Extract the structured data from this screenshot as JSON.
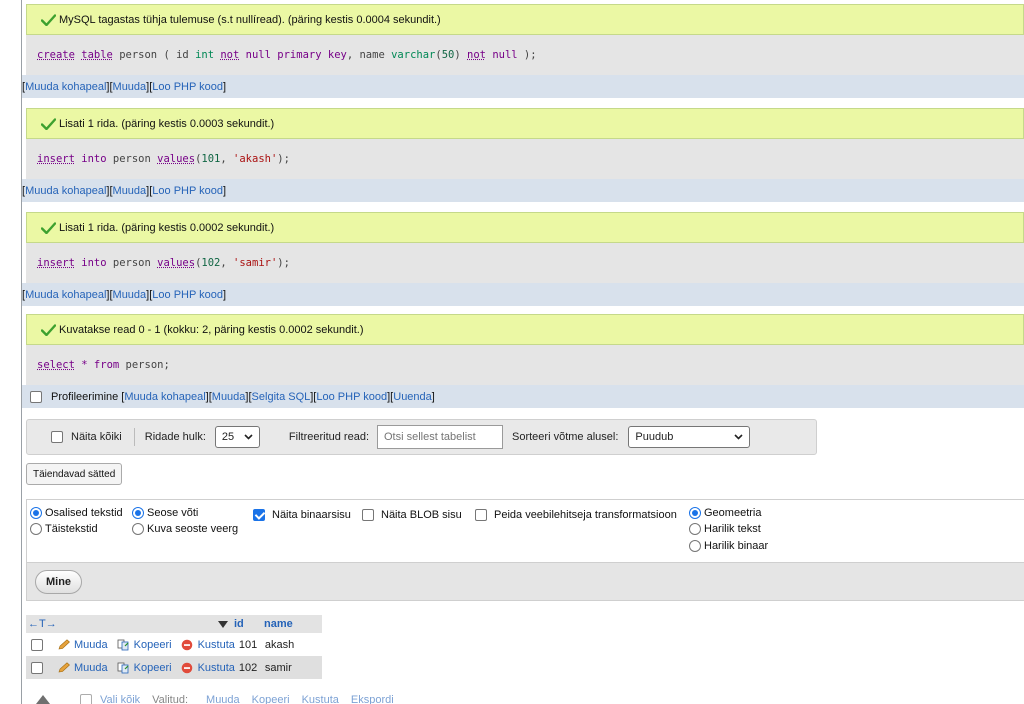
{
  "blocks": [
    {
      "message": "MySQL tagastas tühja tulemuse (s.t nullíread). (päring kestis 0.0004 sekundit.)",
      "sql": [
        {
          "t": "create",
          "c": "kwu"
        },
        {
          "t": " ",
          "c": "plain"
        },
        {
          "t": "table",
          "c": "kwu"
        },
        {
          "t": " person ( id ",
          "c": "plain"
        },
        {
          "t": "int",
          "c": "type"
        },
        {
          "t": " ",
          "c": "plain"
        },
        {
          "t": "not",
          "c": "kwu"
        },
        {
          "t": " ",
          "c": "plain"
        },
        {
          "t": "null",
          "c": "kw"
        },
        {
          "t": " ",
          "c": "plain"
        },
        {
          "t": "primary",
          "c": "kw"
        },
        {
          "t": " ",
          "c": "plain"
        },
        {
          "t": "key",
          "c": "kw"
        },
        {
          "t": ", name ",
          "c": "plain"
        },
        {
          "t": "varchar",
          "c": "type"
        },
        {
          "t": "(",
          "c": "plain"
        },
        {
          "t": "50",
          "c": "num"
        },
        {
          "t": ") ",
          "c": "plain"
        },
        {
          "t": "not",
          "c": "kwu"
        },
        {
          "t": " ",
          "c": "plain"
        },
        {
          "t": "null",
          "c": "kw"
        },
        {
          "t": " );",
          "c": "plain"
        }
      ],
      "links": [
        "Muuda kohapeal",
        "Muuda",
        "Loo PHP kood"
      ]
    },
    {
      "message": "Lisati 1 rida. (päring kestis 0.0003 sekundit.)",
      "sql": [
        {
          "t": "insert",
          "c": "kwu"
        },
        {
          "t": " ",
          "c": "plain"
        },
        {
          "t": "into",
          "c": "kw"
        },
        {
          "t": " person ",
          "c": "plain"
        },
        {
          "t": "values",
          "c": "kwu"
        },
        {
          "t": "(",
          "c": "plain"
        },
        {
          "t": "101",
          "c": "num"
        },
        {
          "t": ", ",
          "c": "plain"
        },
        {
          "t": "'akash'",
          "c": "str"
        },
        {
          "t": ");",
          "c": "plain"
        }
      ],
      "links": [
        "Muuda kohapeal",
        "Muuda",
        "Loo PHP kood"
      ]
    },
    {
      "message": "Lisati 1 rida. (päring kestis 0.0002 sekundit.)",
      "sql": [
        {
          "t": "insert",
          "c": "kwu"
        },
        {
          "t": " ",
          "c": "plain"
        },
        {
          "t": "into",
          "c": "kw"
        },
        {
          "t": " person ",
          "c": "plain"
        },
        {
          "t": "values",
          "c": "kwu"
        },
        {
          "t": "(",
          "c": "plain"
        },
        {
          "t": "102",
          "c": "num"
        },
        {
          "t": ", ",
          "c": "plain"
        },
        {
          "t": "'samir'",
          "c": "str"
        },
        {
          "t": ");",
          "c": "plain"
        }
      ],
      "links": [
        "Muuda kohapeal",
        "Muuda",
        "Loo PHP kood"
      ]
    },
    {
      "message": "Kuvatakse read 0 - 1 (kokku: 2, päring kestis 0.0002 sekundit.)",
      "sql": [
        {
          "t": "select",
          "c": "kwu"
        },
        {
          "t": " ",
          "c": "plain"
        },
        {
          "t": "*",
          "c": "kw"
        },
        {
          "t": " ",
          "c": "plain"
        },
        {
          "t": "from",
          "c": "kw"
        },
        {
          "t": " person;",
          "c": "plain"
        }
      ],
      "profile_label": "Profileerimine",
      "links": [
        "Muuda kohapeal",
        "Muuda",
        "Selgita SQL",
        "Loo PHP kood",
        "Uuenda"
      ]
    }
  ],
  "toolbar": {
    "show_all": "Näita kõiki",
    "rows_label": "Ridade hulk:",
    "rows_value": "25",
    "filter_label": "Filtreeritud read:",
    "filter_placeholder": "Otsi sellest tabelist",
    "sort_label": "Sorteeri võtme alusel:",
    "sort_value": "Puudub"
  },
  "extra_button": "Täiendavad sätted",
  "options": {
    "partial_texts": "Osalised tekstid",
    "full_texts": "Täistekstid",
    "relation_key": "Seose võti",
    "relation_column": "Kuva seoste veerg",
    "show_binary": "Näita binaarsisu",
    "show_blob": "Näita BLOB sisu",
    "hide_transform": "Peida veebilehitseja transformatsioon",
    "geometry": "Geomeetria",
    "plain_text": "Harilik tekst",
    "plain_binary": "Harilik binaar",
    "go": "Mine"
  },
  "table": {
    "arrows": "←T→",
    "columns": [
      "id",
      "name"
    ],
    "edit": "Muuda",
    "copy": "Kopeeri",
    "delete": "Kustuta",
    "rows": [
      {
        "id": "101",
        "name": "akash"
      },
      {
        "id": "102",
        "name": "samir"
      }
    ],
    "bottom": [
      "Vali kõik",
      "Valitud:",
      "Muuda",
      "Kopeeri",
      "Kustuta",
      "Ekspordi"
    ]
  },
  "colors": {
    "success_bg": "#ebf8a4",
    "link": "#2563b8",
    "link_bar": "#d8e1ec"
  }
}
